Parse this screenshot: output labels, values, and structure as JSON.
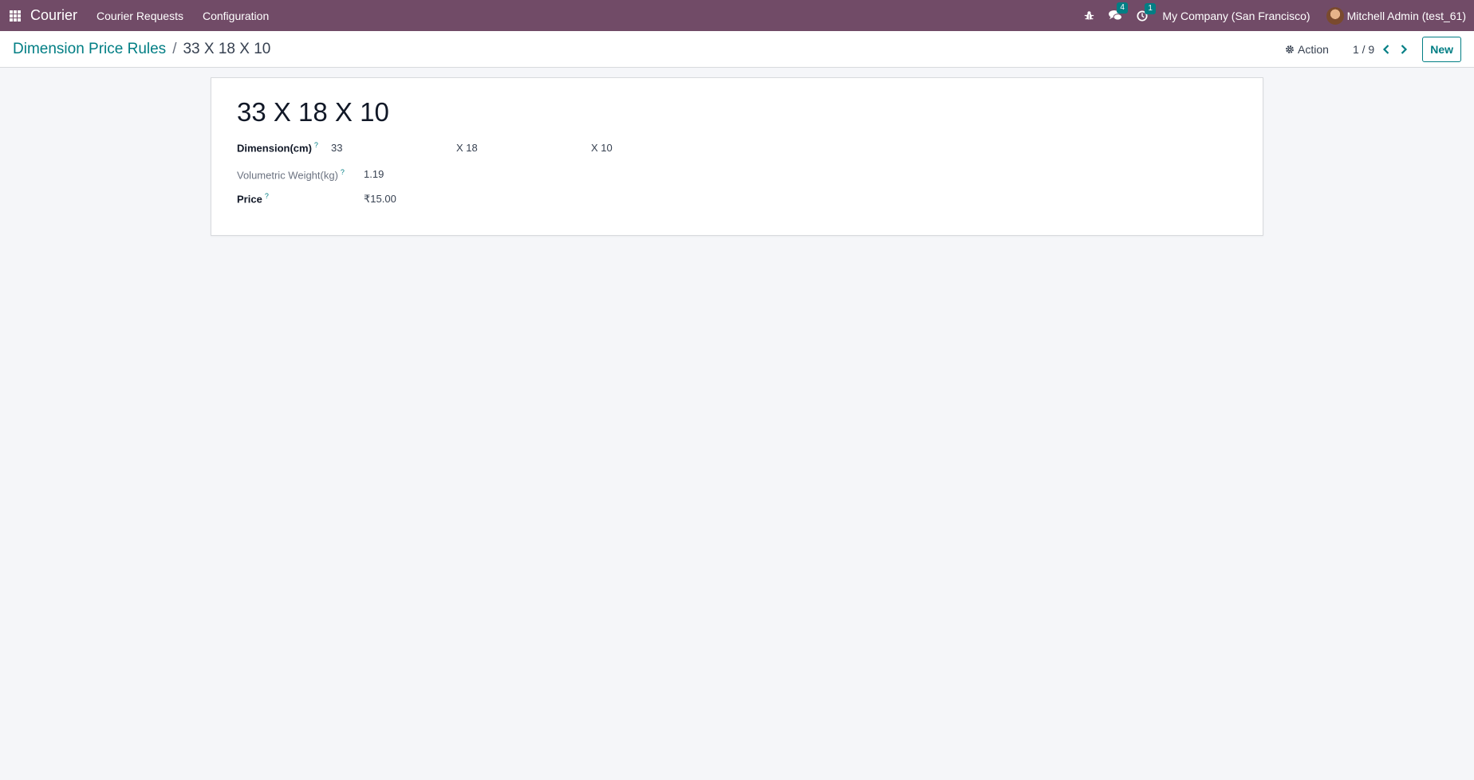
{
  "navbar": {
    "app_name": "Courier",
    "menu": [
      "Courier Requests",
      "Configuration"
    ],
    "messages_count": "4",
    "activities_count": "1",
    "company": "My Company (San Francisco)",
    "user": "Mitchell Admin (test_61)",
    "icons": [
      "apps-grid-icon",
      "bug-icon",
      "chat-icon",
      "clock-icon"
    ],
    "color": "#714b67"
  },
  "control_panel": {
    "breadcrumb_parent": "Dimension Price Rules",
    "breadcrumb_separator": "/",
    "breadcrumb_current": "33 X 18 X 10",
    "action_label": "Action",
    "pager": "1 / 9",
    "new_label": "New",
    "accent_color": "#017e84"
  },
  "form": {
    "title": "33 X 18 X 10",
    "dimension_label": "Dimension(cm)",
    "length": "33",
    "width": "X 18",
    "height": "X 10",
    "volumetric_label": "Volumetric Weight(kg)",
    "volumetric_value": "1.19",
    "price_label": "Price",
    "price_value": "₹15.00",
    "help_mark": "?"
  }
}
